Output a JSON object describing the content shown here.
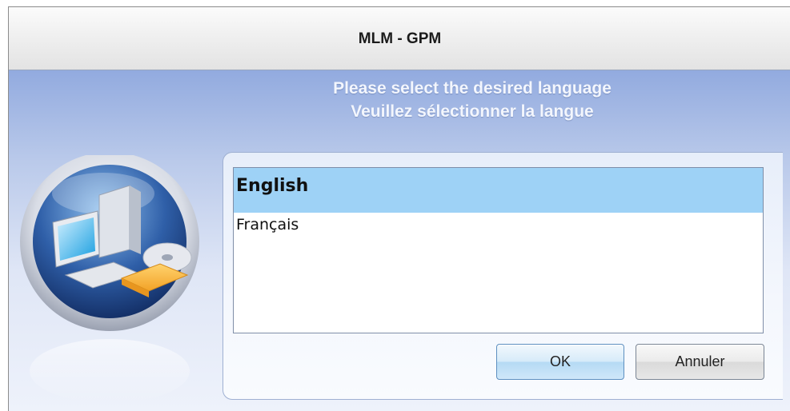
{
  "window": {
    "title": "MLM - GPM"
  },
  "prompt": {
    "line_en": "Please select the desired language",
    "line_fr": "Veuillez sélectionner la langue"
  },
  "languages": {
    "items": [
      {
        "label": "English",
        "selected": true
      },
      {
        "label": "Français",
        "selected": false
      }
    ]
  },
  "buttons": {
    "ok_label": "OK",
    "cancel_label": "Annuler"
  },
  "colors": {
    "selection": "#9ed2f6",
    "background_top": "#6f8fcf",
    "background_bottom": "#eef2fb"
  },
  "icons": {
    "logo": "computer-cd-folder-icon"
  }
}
